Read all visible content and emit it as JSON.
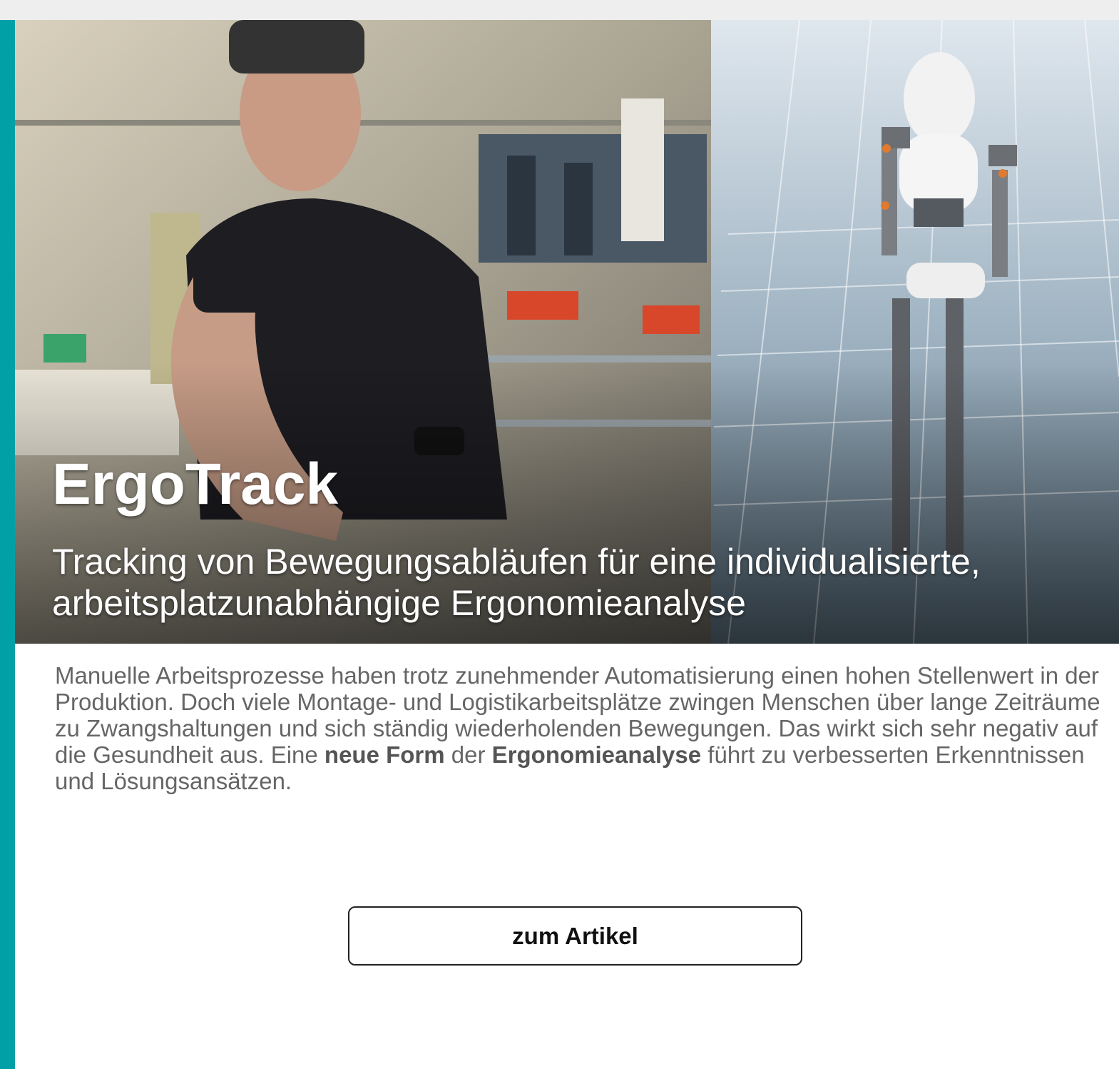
{
  "hero": {
    "title": "ErgoTrack",
    "subtitle_line1": "Tracking von Bewegungsabläufen für eine individualisierte,",
    "subtitle_line2": "arbeitsplatzunabhängige Ergonomieanalyse",
    "image_left": "photo of worker wearing motion sensors at assembly workstation",
    "image_right": "3D avatar mannequin on grid floor"
  },
  "intro": {
    "part1": "Manuelle Arbeitsprozesse haben trotz zunehmender Automatisierung einen hohen Stellenwert in der Produktion. Doch viele Montage- und Logistikarbeitsplätze zwingen Menschen über lange Zeiträume zu Zwangshaltungen und sich ständig wiederholenden Bewegungen. Das wirkt sich sehr negativ auf die Gesundheit aus. Eine ",
    "bold1": "neue Form",
    "part2": " der ",
    "bold2": "Ergonomieanalyse",
    "part3": " führt zu verbesserten Erkenntnissen und Lösungsansätzen."
  },
  "cta": {
    "label": "zum Artikel"
  },
  "colors": {
    "accent": "#00a0a6",
    "topbar": "#eeeeee",
    "text": "#666666"
  }
}
